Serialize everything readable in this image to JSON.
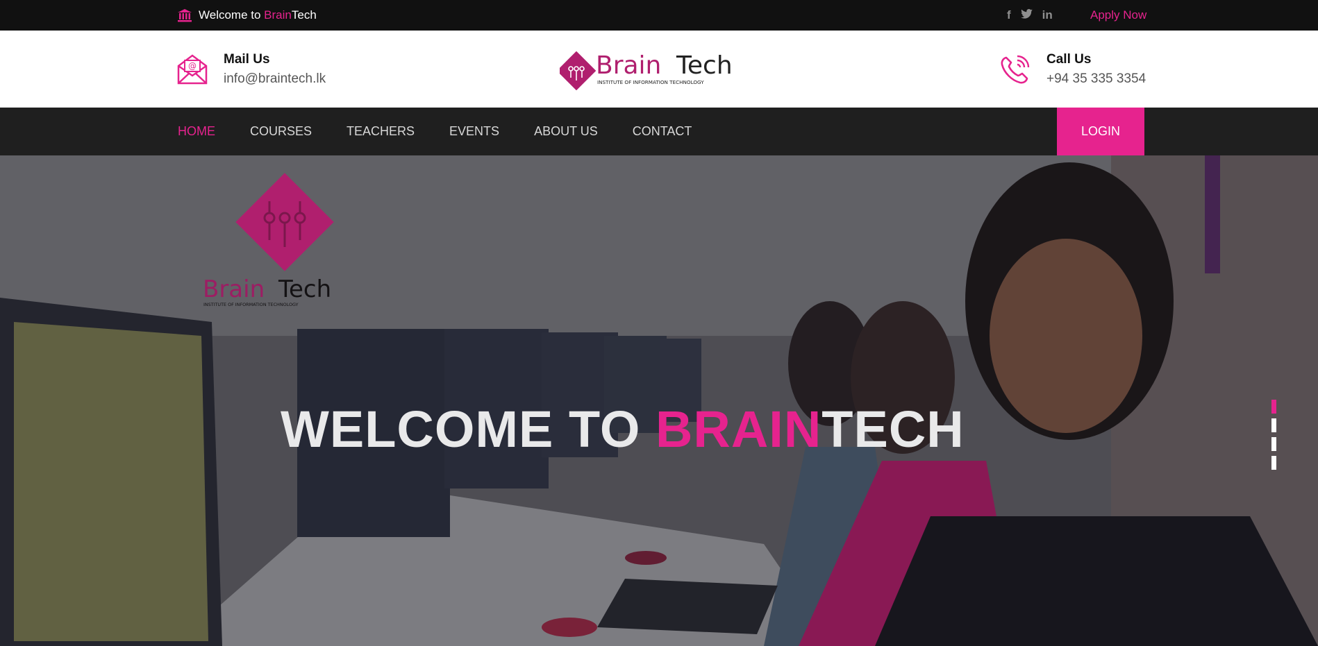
{
  "topbar": {
    "welcome_prefix": "Welcome to ",
    "welcome_brand_pink": "Brain",
    "welcome_brand_rest": "Tech",
    "social": {
      "facebook": "f",
      "twitter": "t",
      "linkedin": "in"
    },
    "apply_label": "Apply Now"
  },
  "header": {
    "mail_title": "Mail Us",
    "mail_value": "info@braintech.lk",
    "call_title": "Call Us",
    "call_value": "+94 35 335 3354",
    "logo_brain": "Brain",
    "logo_tech": "Tech",
    "logo_tagline": "INSTITUTE OF INFORMATION TECHNOLOGY"
  },
  "nav": {
    "items": [
      {
        "label": "HOME",
        "active": true
      },
      {
        "label": "COURSES"
      },
      {
        "label": "TEACHERS"
      },
      {
        "label": "EVENTS"
      },
      {
        "label": "ABOUT US"
      },
      {
        "label": "CONTACT"
      }
    ],
    "login_label": "LOGIN"
  },
  "hero": {
    "headline_part1": "WELCOME TO ",
    "headline_pink": "BRAIN",
    "headline_part2": "TECH",
    "logo_brain": "Brain",
    "logo_tech": "Tech",
    "logo_tagline": "INSTITUTE OF INFORMATION TECHNOLOGY",
    "slide_count": 4,
    "active_slide": 1
  },
  "colors": {
    "accent": "#e6238e",
    "topbar_bg": "#111111",
    "nav_bg": "#1f1f1f"
  }
}
